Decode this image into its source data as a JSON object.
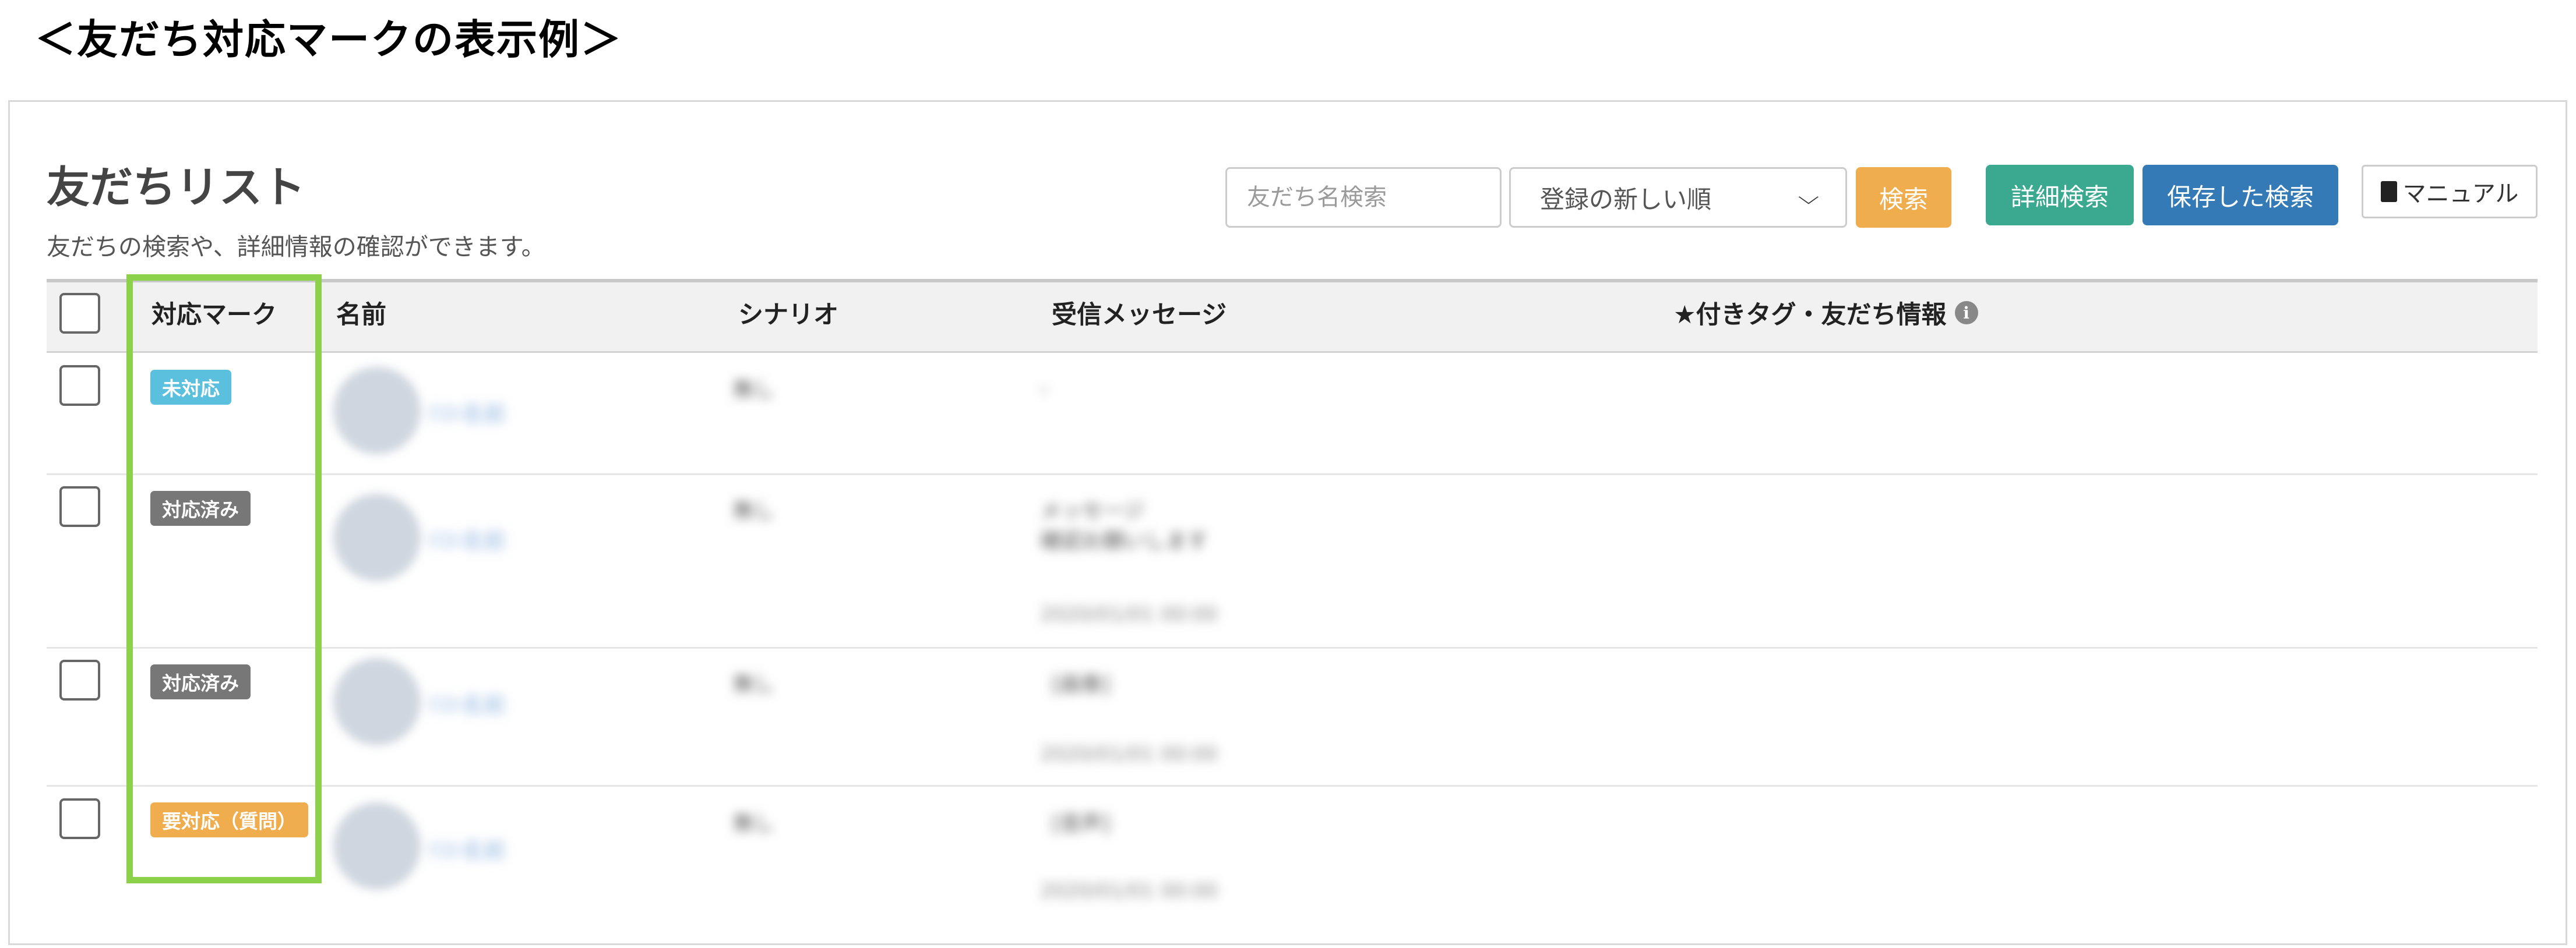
{
  "caption": "＜友だち対応マークの表示例＞",
  "header": {
    "title": "友だちリスト",
    "description": "友だちの検索や、詳細情報の確認ができます。"
  },
  "toolbar": {
    "search_placeholder": "友だち名検索",
    "sort_selected": "登録の新しい順",
    "search_button": "検索",
    "detail_search_button": "詳細検索",
    "saved_search_button": "保存した検索",
    "manual_button": "マニュアル"
  },
  "table": {
    "columns": [
      "対応マーク",
      "名前",
      "シナリオ",
      "受信メッセージ",
      "★付きタグ・友だち情報"
    ],
    "rows": [
      {
        "mark": "未対応",
        "mark_color": "#5bc0de"
      },
      {
        "mark": "対応済み",
        "mark_color": "#777777"
      },
      {
        "mark": "対応済み",
        "mark_color": "#777777"
      },
      {
        "mark": "要対応（質問）",
        "mark_color": "#f0ad4e"
      }
    ]
  },
  "colors": {
    "highlight": "#8cd14a",
    "search_button": "#f0ad4e",
    "detail_search_button": "#3aa98f",
    "saved_search_button": "#337ab7"
  },
  "icons": {
    "manual": "book-icon",
    "sort": "chevron-down-icon",
    "info": "info-icon"
  }
}
